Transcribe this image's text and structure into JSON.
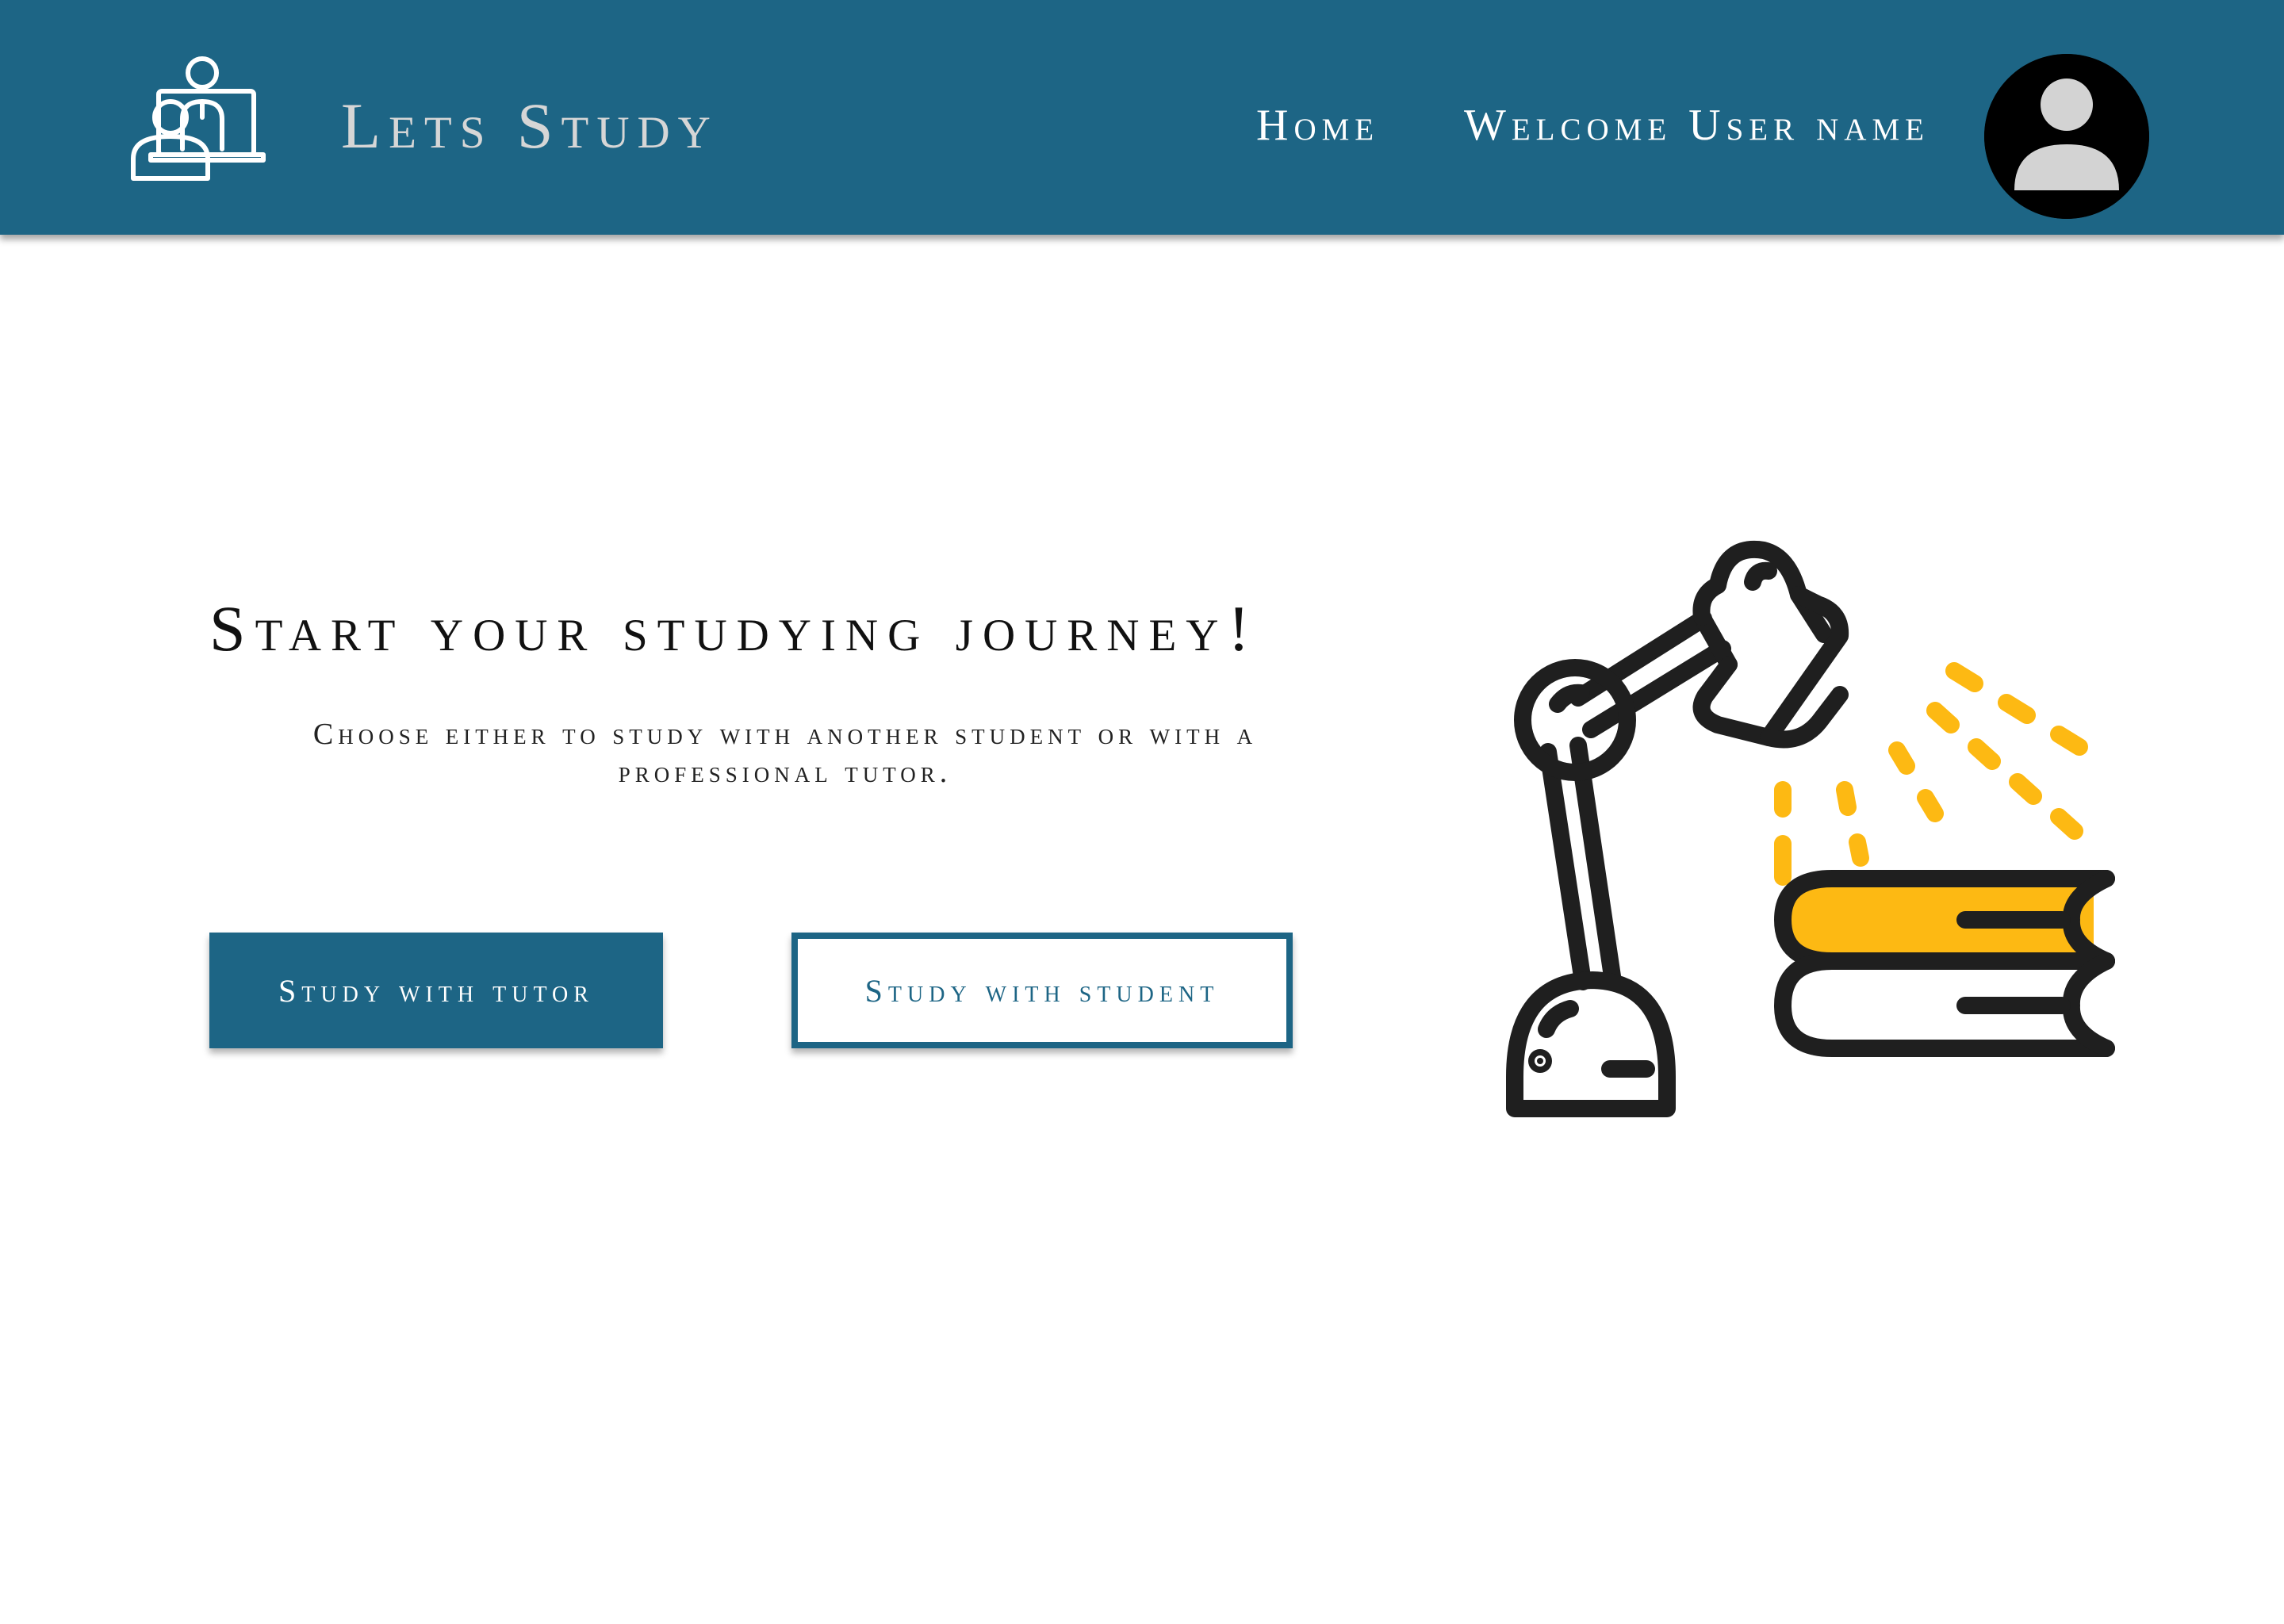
{
  "header": {
    "brand": "Lets Study",
    "nav_home": "Home",
    "welcome": "Welcome User name",
    "logo_icon": "tutor-video-call-icon",
    "avatar_icon": "user-avatar-icon"
  },
  "hero": {
    "title": "Start your studying journey!",
    "subtitle": "Choose either to study with another student or with a professional tutor.",
    "btn_tutor": "Study with tutor",
    "btn_student": "Study with student",
    "illustration_icon": "desk-lamp-books-icon"
  },
  "colors": {
    "header_bg": "#1d6585",
    "brand_text": "#d6d6d6",
    "accent_yellow": "#fdb913",
    "outline_dark": "#1f1f1f"
  }
}
